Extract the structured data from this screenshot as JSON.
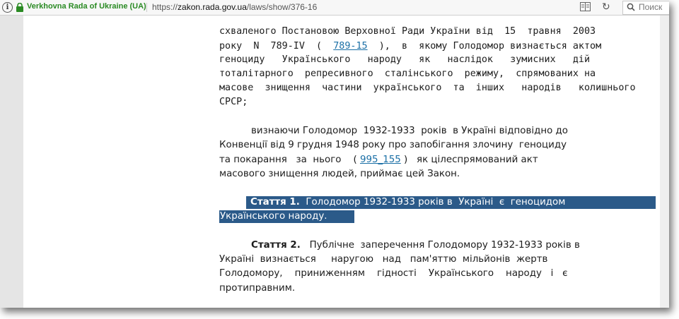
{
  "browser": {
    "site_name": "Verkhovna Rada of Ukraine (UA)",
    "url_scheme": "https://",
    "url_host": "zakon.rada.gov.ua",
    "url_path": "/laws/show/376-16",
    "search_placeholder": "Поиск"
  },
  "document": {
    "l0": "схваленого Постановою Верховної Ради України від  15  травня  2003",
    "l1a": "року  N  789-IV  (  ",
    "l1_link": "789-15",
    "l1b": "  ),  в  якому Голодомор визнається актом",
    "l2": "геноциду   Українського   народу   як   наслідок   зумисних   дій",
    "l3": "тоталітарного  репресивного  сталінського  режиму,  спрямованих на",
    "l4": "масове  знищення  частини  українського  та  інших   народів   колишнього",
    "l5": "СРСР;",
    "p2_l0": "визнаючи Голодомор  1932-1933  років  в Україні відповідно до",
    "p2_l1": "Конвенції від 9 грудня 1948 року про запобігання злочину  геноциду",
    "p2_l2a": "та покарання   за  нього    ( ",
    "p2_link": "995_155",
    "p2_l2b": " )   як цілеспрямований акт",
    "p2_l3": "масового знищення людей, приймає цей Закон.",
    "art1_label": "Стаття 1.",
    "art1_l0": "Голодомор 1932-1933 років в  Україні  є  геноцидом",
    "art1_l1": "Українського народу.",
    "art2_label": "Стаття 2.",
    "art2_l0": "Публічне  заперечення Голодомору 1932-1933 років в",
    "art2_l1": "Україні  визнається     наругою   над   пам'яттю  мільйонів  жертв",
    "art2_l2": "Голодомору,    приниженням    гідності    Українського    народу   і   є",
    "art2_l3": "протиправним."
  },
  "colors": {
    "site_green": "#2a8a23",
    "link_blue": "#1a6fa6",
    "selection": "#2b5a89"
  }
}
